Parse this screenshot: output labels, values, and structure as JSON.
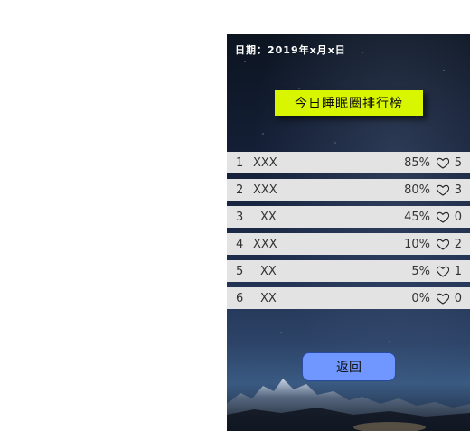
{
  "header": {
    "date_label": "日期：2019年x月x日",
    "title": "今日睡眠圈排行榜"
  },
  "rankings": [
    {
      "rank": "1",
      "name": "XXX",
      "percent": "85%",
      "likes": "5"
    },
    {
      "rank": "2",
      "name": "XXX",
      "percent": "80%",
      "likes": "3"
    },
    {
      "rank": "3",
      "name": "XX",
      "percent": "45%",
      "likes": "0"
    },
    {
      "rank": "4",
      "name": "XXX",
      "percent": "10%",
      "likes": "2"
    },
    {
      "rank": "5",
      "name": "XX",
      "percent": "5%",
      "likes": "1"
    },
    {
      "rank": "6",
      "name": "XX",
      "percent": "0%",
      "likes": "0"
    }
  ],
  "footer": {
    "back_label": "返回"
  },
  "colors": {
    "title_bg": "#d8f600",
    "row_bg": "#e3e3e3",
    "button_bg": "#6f97ff"
  }
}
